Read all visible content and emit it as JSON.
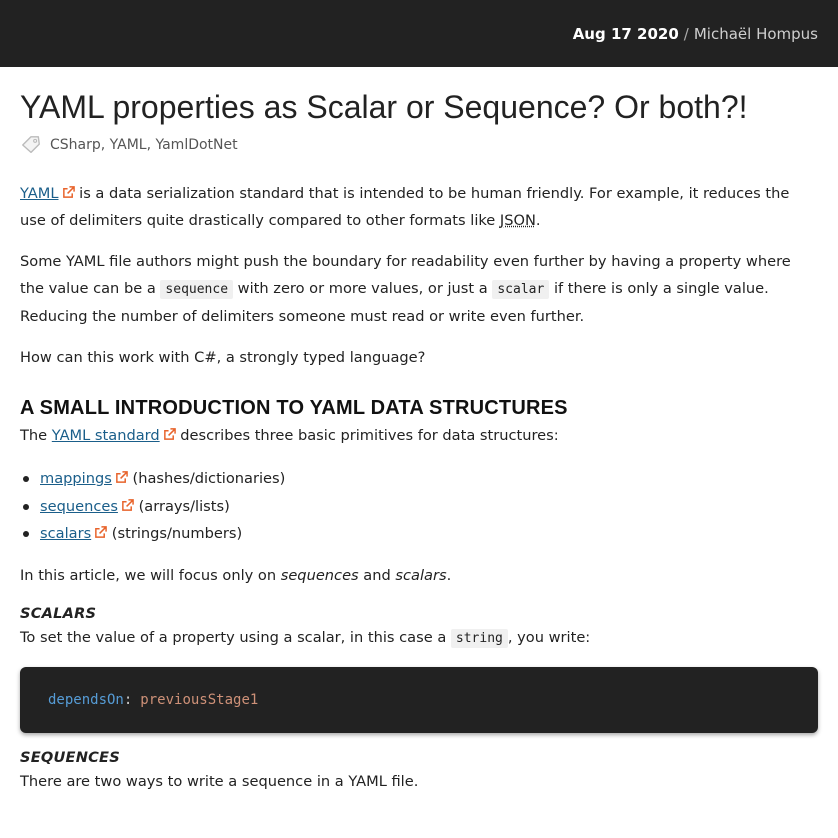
{
  "header": {
    "date": "Aug 17 2020",
    "separator": "/",
    "author": "Michaël Hompus"
  },
  "article": {
    "title": "YAML properties as Scalar or Sequence? Or both?!",
    "tags": "CSharp, YAML, YamlDotNet",
    "intro": {
      "link": "YAML",
      "text1": " is a data serialization standard that is intended to be human friendly. For example, it reduces the use of delimiters quite drastically compared to other formats like ",
      "abbr": "JSON",
      "text2": "."
    },
    "para2": {
      "text1": "Some YAML file authors might push the boundary for readability even further by having a property where the value can be a ",
      "code1": "sequence",
      "text2": " with zero or more values, or just a ",
      "code2": "scalar",
      "text3": " if there is only a single value. Reducing the number of delimiters someone must read or write even further."
    },
    "para3": "How can this work with C#, a strongly typed language?",
    "section1": {
      "heading": "A SMALL INTRODUCTION TO YAML DATA STRUCTURES",
      "text1": "The ",
      "link": "YAML standard",
      "text2": " describes three basic primitives for data structures:"
    },
    "list": [
      {
        "link": "mappings",
        "note": " (hashes/dictionaries)"
      },
      {
        "link": "sequences",
        "note": " (arrays/lists)"
      },
      {
        "link": "scalars",
        "note": " (strings/numbers)"
      }
    ],
    "focus": {
      "text1": "In this article, we will focus only on ",
      "em1": "sequences",
      "text2": " and ",
      "em2": "scalars",
      "text3": "."
    },
    "scalars": {
      "heading": "SCALARS",
      "text1": "To set the value of a property using a scalar, in this case a ",
      "code": "string",
      "text2": ", you write:"
    },
    "code_example": {
      "key": "dependsOn",
      "colon": ":",
      "value": "previousStage1"
    },
    "sequences": {
      "heading": "SEQUENCES",
      "text": "There are two ways to write a sequence in a YAML file."
    }
  },
  "colors": {
    "link": "#1a5e8a",
    "external_icon": "#e8632b",
    "code_key": "#569cd6",
    "code_value": "#ce9178"
  }
}
